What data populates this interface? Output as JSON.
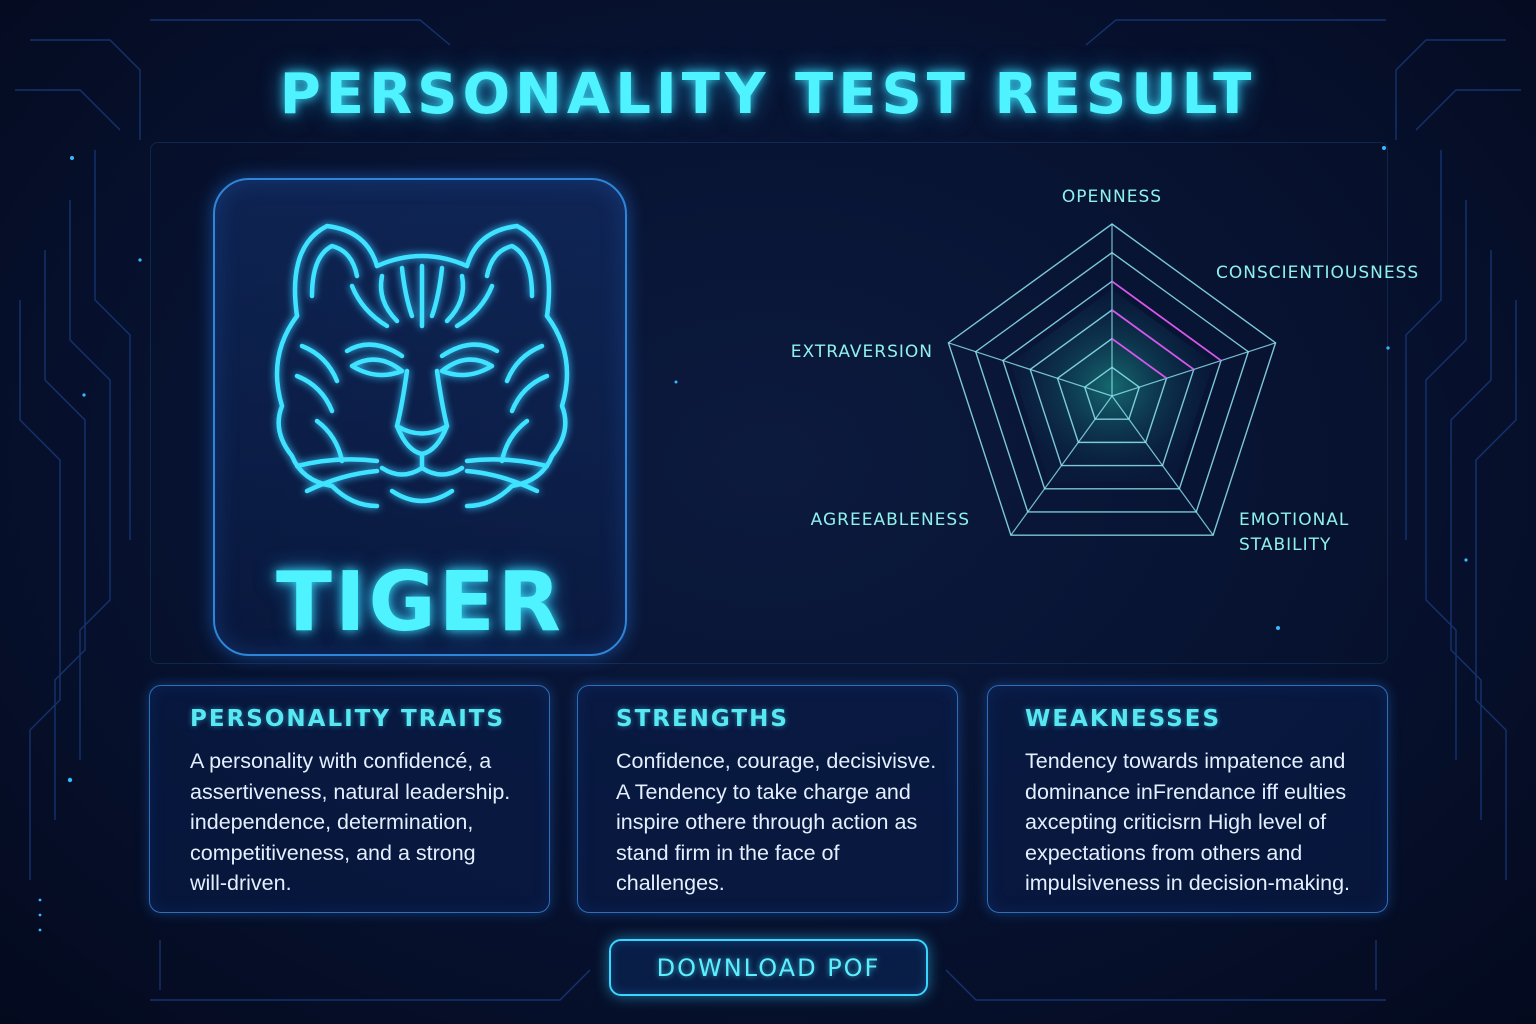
{
  "page": {
    "title": "PERSONALITY TEST RESULT",
    "accent_color": "#4ff3ff",
    "background_color": "#071230"
  },
  "result": {
    "animal_name": "TIGER",
    "animal_icon": "tiger-face-icon"
  },
  "radar": {
    "axes": [
      {
        "label_lines": [
          "OPENNESS"
        ]
      },
      {
        "label_lines": [
          "CONSCIENTIOUSNESS"
        ]
      },
      {
        "label_lines": [
          "EMOTIONAL",
          "STABILITY"
        ]
      },
      {
        "label_lines": [
          "AGREEABLENESS"
        ]
      },
      {
        "label_lines": [
          "EXTRAVERSION"
        ]
      }
    ],
    "levels": 6,
    "highlight_color": "#e04bf0"
  },
  "cards": {
    "traits": {
      "heading": "PERSONALITY TRAITS",
      "lines": [
        "A personality with confidencé, a",
        "assertiveness, natural leadership.",
        "independence, determination,",
        "competitiveness, and a strong",
        "will-driven."
      ]
    },
    "strengths": {
      "heading": "STRENGTHS",
      "lines": [
        "Confidence, courage, decisivisve.",
        "A Tendency to take charge and",
        "inspire othere through action as",
        "stand firm in the face of",
        "challenges."
      ]
    },
    "weaknesses": {
      "heading": "WEAKNESSES",
      "lines": [
        "Tendency towards impatence and",
        "dominance inFrendance iff eulties",
        "axcepting criticisrn High level of",
        "expectations from others and",
        "impulsiveness in decision-making."
      ]
    }
  },
  "actions": {
    "download_label": "DOWNLOAD POF"
  }
}
